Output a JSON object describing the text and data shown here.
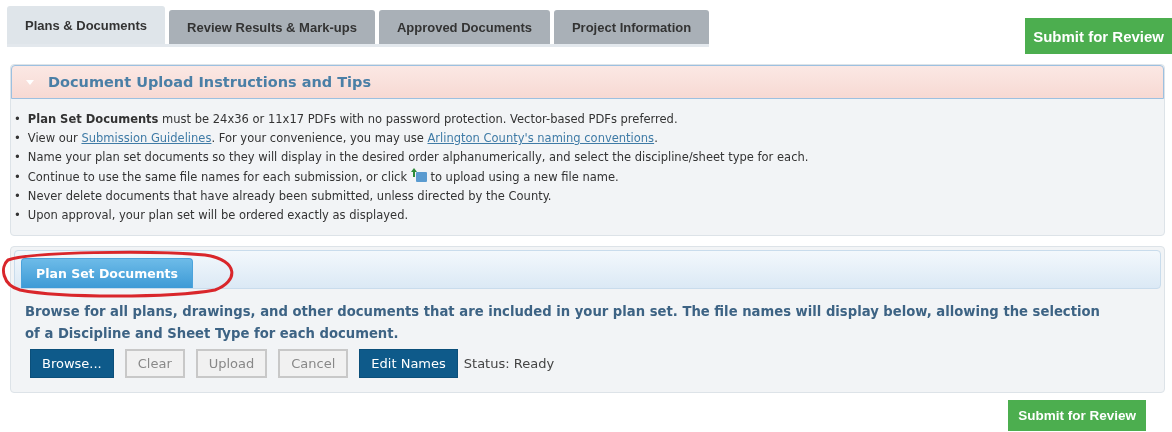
{
  "tabs": [
    {
      "label": "Plans & Documents",
      "selected": true
    },
    {
      "label": "Review Results & Mark-ups",
      "selected": false
    },
    {
      "label": "Approved Documents",
      "selected": false
    },
    {
      "label": "Project Information",
      "selected": false
    }
  ],
  "submit_top": "Submit for Review",
  "instructions": {
    "title": "Document Upload Instructions and Tips",
    "expanded": true,
    "bullet": "•",
    "items": [
      [
        {
          "kind": "text",
          "text": "**Plan Set Documents** must be 24x36 or 11x17 PDFs with no password protection. Vector-based PDFs preferred."
        }
      ],
      [
        {
          "kind": "text",
          "text": "View our "
        },
        {
          "kind": "link",
          "text": "Submission Guidelines"
        },
        {
          "kind": "text",
          "text": ". For your convenience, you may use "
        },
        {
          "kind": "link",
          "text": "Arlington County's naming conventions"
        },
        {
          "kind": "text",
          "text": "."
        }
      ],
      [
        {
          "kind": "text",
          "text": "Name your plan set documents so they will display in the desired order alphanumerically, and select the discipline/sheet type for each."
        }
      ],
      [
        {
          "kind": "text",
          "text": "Continue to use the same file names for each submission, or click "
        },
        {
          "kind": "icon"
        },
        {
          "kind": "text",
          "text": " to upload using a new file name."
        }
      ],
      [
        {
          "kind": "text",
          "text": "Never delete documents that have already been submitted, unless directed by the County."
        }
      ],
      [
        {
          "kind": "text",
          "text": "Upon approval, your plan set will be ordered exactly as displayed."
        }
      ]
    ]
  },
  "upload": {
    "tabs": [
      {
        "label": "Plan Set Documents",
        "selected": true
      }
    ],
    "description": "Browse for all plans, drawings, and other documents that are included in your plan set. The file names will display below, allowing the selection of a Discipline and Sheet Type for each document.",
    "buttons": [
      {
        "label": "Browse...",
        "disabled": false
      },
      {
        "label": "Clear",
        "disabled": true
      },
      {
        "label": "Upload",
        "disabled": true
      },
      {
        "label": "Cancel",
        "disabled": true
      },
      {
        "label": "Edit Names",
        "disabled": false
      }
    ],
    "status": "Status: Ready"
  },
  "submit_bottom": "Submit for Review"
}
